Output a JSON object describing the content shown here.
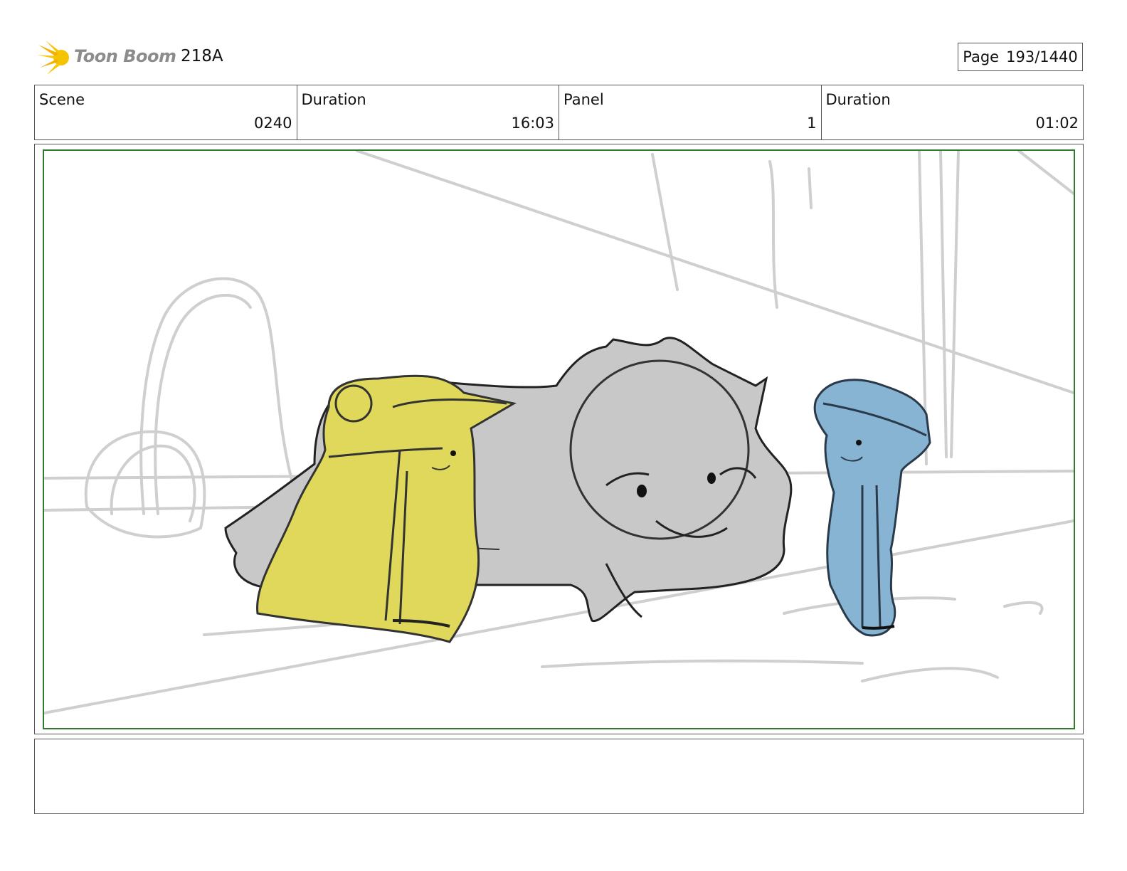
{
  "header": {
    "logo_text": "Toon Boom",
    "project": "218A",
    "page_label": "Page",
    "page_value": "193/1440"
  },
  "info": {
    "scene_label": "Scene",
    "scene_value": "0240",
    "duration_label": "Duration",
    "duration_value": "16:03",
    "panel_label": "Panel",
    "panel_value": "1",
    "panel_duration_label": "Duration",
    "panel_duration_value": "01:02"
  },
  "colors": {
    "frame_border": "#2f7a2f",
    "yellow_character": "#e0d85a",
    "blue_character": "#86b4d2",
    "gray_creature": "#c8c8c8"
  },
  "notes": {
    "text": ""
  }
}
